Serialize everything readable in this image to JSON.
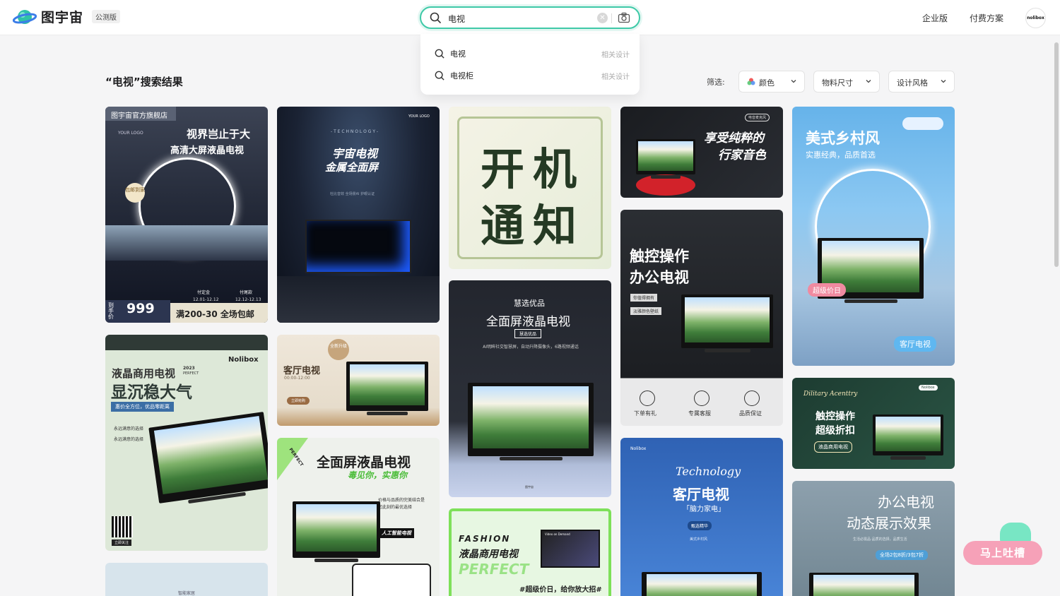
{
  "header": {
    "brand": "图宇宙",
    "beta_badge": "公测版",
    "search_value": "电视",
    "nav": {
      "enterprise": "企业版",
      "pricing": "付费方案"
    },
    "avatar_text": "nolibox"
  },
  "suggestions": [
    {
      "text": "电视",
      "tag": "相关设计"
    },
    {
      "text": "电视柜",
      "tag": "相关设计"
    }
  ],
  "results": {
    "title": "“电视”搜索结果",
    "filter_label": "筛选:",
    "filters": [
      "颜色",
      "物料尺寸",
      "设计风格"
    ]
  },
  "cards": {
    "c1": {
      "store": "图宇宙官方旗舰店",
      "logo": "YOUR LOGO",
      "h1": "视界岂止于大",
      "h2": "高清大屏液晶电视",
      "badge": "包邮到家",
      "dep": "付定金",
      "fin": "付尾款",
      "d1": "12.01-12.12",
      "d2": "12.12-12.13",
      "price": "999",
      "tag": "到手价",
      "promo": "满200-30 全场包邮"
    },
    "c2": {
      "logo": "YOUR LOGO",
      "tech": "- T E C H N O L O G Y -",
      "h1": "宇宙电视",
      "h2": "金属全面屏",
      "sub": "杜比音效 全场景AI 护眼认证"
    },
    "c3": {
      "l1": "开机",
      "l2": "通知"
    },
    "c4": {
      "tag": "电音麦克风",
      "h1": "享受纯粹的",
      "h2": "行家音色"
    },
    "c5": {
      "h1": "美式乡村风",
      "sub": "实惠经典，品质首选",
      "badge": "超级价日",
      "btn": "客厅电视"
    },
    "c6": {
      "brand": "Nolibox",
      "h1": "液晶商用电视",
      "year": "2023",
      "perfect": "PERFECT",
      "h2": "显沉稳大气",
      "bar": "惠价全方位，优品零距离",
      "c1": "永远满意的选择",
      "c2": "永远满意的选择",
      "qr": "立即关注"
    },
    "c7": {
      "h1": "客厅电视",
      "time": "00:00-12:00",
      "btn": "立即抢购",
      "seal": "全新升级"
    },
    "c8": {
      "top": "慧选优品",
      "h1": "全面屏液晶电视",
      "tag": "慧选优品",
      "sub": "AI明眸社交智慧屏，自动升降摄像头，6路视频通话",
      "foot": "图宇宙"
    },
    "c9": {
      "h1": "触控操作",
      "h2": "办公电视",
      "t1": "你值得拥有",
      "t2": "淡雅颜色壁纸",
      "i1": "下单有礼",
      "i2": "专属客服",
      "i3": "品质保证"
    },
    "c10": {
      "h1": "触控操作",
      "h2": "超级折扣",
      "tag": "液晶商用电视",
      "script": "Dilitary Acenttry",
      "brand": "Nolibox"
    },
    "c11": {
      "h1": "全面屏液晶电视",
      "h2": "毒见你，实惠你",
      "side": "PERFECT",
      "p": "价格与品质的完美结合是您此刻的最优选择",
      "tag": "人工智能电视"
    },
    "c12": {
      "brand": "Nolibox",
      "script": "Technology",
      "h1": "客厅电视",
      "h2": "「脑力家电」",
      "tag": "甄选精华",
      "sub": "美式乡村风"
    },
    "c13": {
      "h1": "办公电视",
      "h2": "动态展示效果",
      "sub": "生活必需品·品质的选择，品质生活",
      "tag": "全场2包8折/3包7折"
    },
    "c14": {
      "h1": "FASHION",
      "h2": "液晶商用电视",
      "h3": "PERFECT",
      "promo": "#超级价日，给你放大招#",
      "tv": "Video on Demand"
    },
    "c15": {
      "tag": "智能家居"
    }
  },
  "feedback": "马上吐槽"
}
